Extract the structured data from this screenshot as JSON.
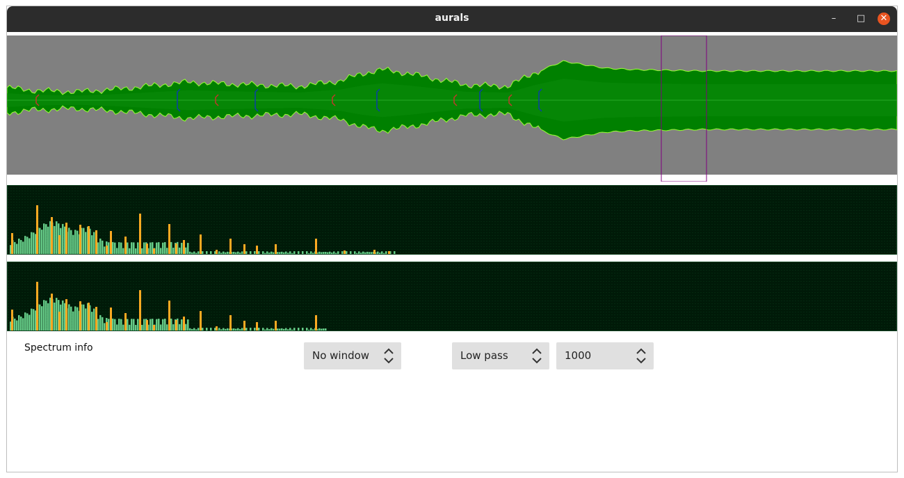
{
  "window": {
    "title": "aurals"
  },
  "titlebar_buttons": {
    "minimize": "–",
    "maximize": "□",
    "close": "✕"
  },
  "colors": {
    "waveform_bg": "#808080",
    "waveform_fill": "#008000",
    "waveform_dark": "#006600",
    "waveform_edge": "#99ff33",
    "selection": "#800080",
    "spectrum_bg": "#001a08",
    "spectrum_bar": "#66cc88",
    "spectrum_peak": "#ffaa22",
    "marker_blue": "#0a3fa8",
    "marker_red": "#c0392b"
  },
  "controls": {
    "spectrum_info_label": "Spectrum info",
    "window_select": {
      "value": "No window"
    },
    "filter_select": {
      "value": "Low pass"
    },
    "cutoff_spin": {
      "value": "1000"
    }
  }
}
